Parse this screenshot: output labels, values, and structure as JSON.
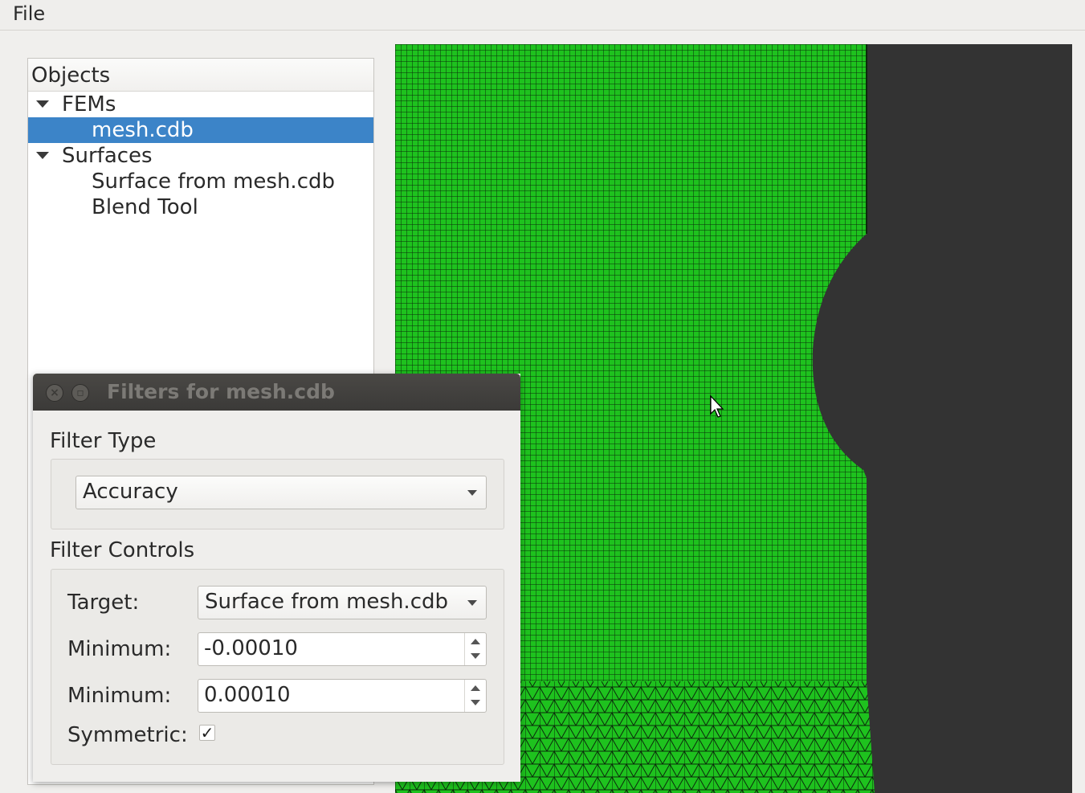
{
  "menu": {
    "file_label": "File"
  },
  "objects_panel": {
    "header": "Objects",
    "tree": [
      {
        "label": "FEMs",
        "expanded": true,
        "level": 0
      },
      {
        "label": "mesh.cdb",
        "level": 1,
        "selected": true
      },
      {
        "label": "Surfaces",
        "expanded": true,
        "level": 0
      },
      {
        "label": "Surface from mesh.cdb",
        "level": 1
      },
      {
        "label": "Blend Tool",
        "level": 1
      }
    ]
  },
  "viewport": {
    "mesh_color": "#1ec21e",
    "background_color": "#333333"
  },
  "filters_dialog": {
    "title": "Filters for mesh.cdb",
    "filter_type_label": "Filter Type",
    "filter_type_value": "Accuracy",
    "filter_controls_label": "Filter Controls",
    "target_label": "Target:",
    "target_value": "Surface from mesh.cdb",
    "minimum_label": "Minimum:",
    "minimum_value": "-0.00010",
    "maximum_label": "Minimum:",
    "maximum_value": "0.00010",
    "symmetric_label": "Symmetric:",
    "symmetric_checked": true,
    "symmetric_mark": "✓"
  },
  "colors": {
    "selection": "#3c84c8",
    "titlebar": "#3d3b39"
  }
}
